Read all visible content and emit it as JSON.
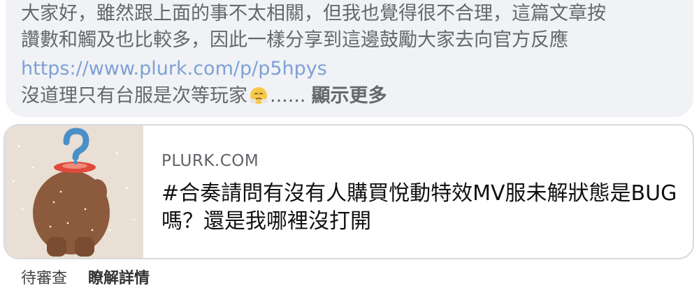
{
  "post": {
    "text_line1": "大家好，雖然跟上面的事不太相關，但我也覺得很不合理，這篇文章按",
    "text_line2": "讚數和觸及也比較多，因此一樣分享到這邊鼓勵大家去向官方反應",
    "link": "https://www.plurk.com/p/p5hpys",
    "text_line4_before": "沒道理只有台服是次等玩家",
    "ellipsis": "......",
    "emoji": "steam-from-nose-face",
    "see_more": "顯示更多"
  },
  "link_preview": {
    "domain": "PLURK.COM",
    "title": "#合奏請問有沒有人購買悅動特效MV服未解狀態是BUG嗎？還是我哪裡沒打開",
    "thumbnail": "bear-with-question-mark-head"
  },
  "actions": {
    "pending_review": "待審查",
    "learn_more": "瞭解詳情"
  },
  "colors": {
    "bubble_bg": "#f0f2f5",
    "link_color": "#7ea0d6",
    "muted_text": "#65676b"
  }
}
